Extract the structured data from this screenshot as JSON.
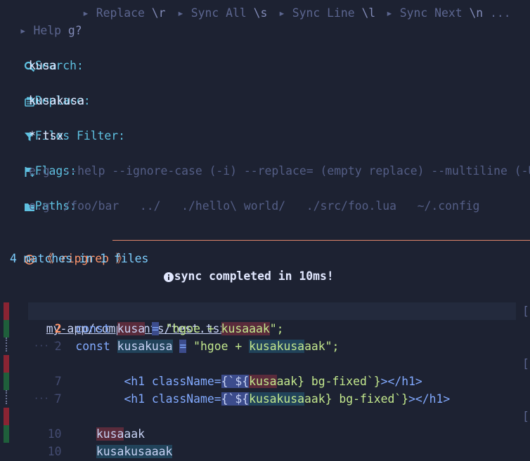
{
  "help_bar": {
    "items": [
      {
        "label": "Help",
        "key": "g?"
      },
      {
        "label": "Replace",
        "key": "\\r"
      },
      {
        "label": "Sync All",
        "key": "\\s"
      },
      {
        "label": "Sync Line",
        "key": "\\l"
      },
      {
        "label": "Sync Next",
        "key": "\\n"
      }
    ],
    "more": "..."
  },
  "form": {
    "search": {
      "label": "Search:",
      "value": "kusa",
      "icon": "search-icon"
    },
    "replace": {
      "label": "Replace:",
      "value": "kusakusa",
      "icon": "replace-icon"
    },
    "files_filter": {
      "label": "Files Filter:",
      "value": "*.tsx",
      "icon": "filter-icon"
    },
    "flags": {
      "label": "Flags:",
      "placeholder": "e.g. --help --ignore-case (-i) --replace= (empty replace) --multiline (-U)",
      "icon": "flag-icon"
    },
    "paths": {
      "label": "Paths:",
      "placeholder": "e.g. /foo/bar   ../   ./hello\\ world/   ./src/foo.lua   ~/.config",
      "icon": "folder-icon"
    }
  },
  "engine": {
    "name": "《 ripgrep 》",
    "accent": "#ff966c"
  },
  "status": {
    "matches": "4 matches in 1 files",
    "sync": "sync completed in 10ms!"
  },
  "file": {
    "path": "my-app/components/test.tsx",
    "icon": "react-icon"
  },
  "results": {
    "l1_num": "2",
    "l1_a": "const ",
    "l1_match": "kusa",
    "l1_b": " ",
    "l1_eq": "=",
    "l1_c": " \"hgoe + ",
    "l1_m2a": "kusa",
    "l1_m2b": "aak",
    "l1_d": "\";",
    "l2_num": "2",
    "l2_a": "const ",
    "l2_match": "kusakusa",
    "l2_b": " ",
    "l2_eq": "=",
    "l2_c": " \"hgoe + ",
    "l2_m2": "kusakusa",
    "l2_m2b": "aak",
    "l2_d": "\";",
    "sep": "··· ‾",
    "l3_num": "7",
    "l3_a": "<h1 className=",
    "l3_b": "{`${",
    "l3_match": "kusa",
    "l3_c": "aak} bg-fixed`}",
    "l3_d": "></h1>",
    "l4_num": "7",
    "l4_a": "<h1 className=",
    "l4_b": "{`${",
    "l4_match": "kusakusa",
    "l4_c": "aak} bg-fixed`}",
    "l4_d": "></h1>",
    "l5_num": "10",
    "l5_match": "kusa",
    "l5_rest": "aak",
    "l6_num": "10",
    "l6_match": "kusakusa",
    "l6_rest": "aak",
    "right_marks": [
      "[",
      "[",
      "[",
      "["
    ]
  }
}
